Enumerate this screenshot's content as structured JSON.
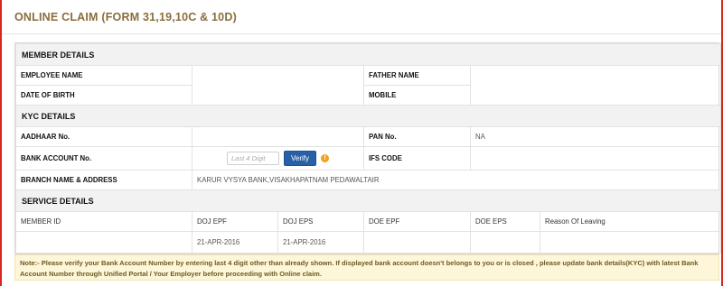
{
  "header": {
    "title": "ONLINE CLAIM (FORM 31,19,10C & 10D)"
  },
  "member_details": {
    "section_title": "MEMBER DETAILS",
    "employee_name_label": "EMPLOYEE NAME",
    "employee_name_value": "",
    "father_name_label": "FATHER NAME",
    "father_name_value": "",
    "dob_label": "DATE OF BIRTH",
    "dob_value": "",
    "mobile_label": "MOBILE",
    "mobile_value": ""
  },
  "kyc_details": {
    "section_title": "KYC DETAILS",
    "aadhaar_label": "AADHAAR No.",
    "aadhaar_value": "",
    "pan_label": "PAN No.",
    "pan_value": "NA",
    "bank_account_label": "BANK ACCOUNT No.",
    "bank_input_placeholder": "Last 4 Digit",
    "verify_label": "Verify",
    "info_icon_glyph": "!",
    "ifsc_label": "IFS CODE",
    "ifsc_value": "",
    "branch_label": "BRANCH NAME & ADDRESS",
    "branch_value": "KARUR VYSYA BANK,VISAKHAPATNAM PEDAWALTAIR"
  },
  "service_details": {
    "section_title": "SERVICE DETAILS",
    "columns": [
      "MEMBER ID",
      "DOJ EPF",
      "DOJ EPS",
      "DOE EPF",
      "DOE EPS",
      "Reason Of Leaving"
    ],
    "rows": [
      [
        "",
        "21-APR-2016",
        "21-APR-2016",
        "",
        "",
        ""
      ]
    ]
  },
  "note": "Note:- Please verify your Bank Account Number by entering last 4 digit other than already shown. If displayed bank account doesn't belongs to you or is closed , please update bank details(KYC) with latest Bank Account Number through Unified Portal / Your Employer before proceeding with Online claim.",
  "colors": {
    "title": "#8a6d3b",
    "verify_button": "#2860a8",
    "info_icon": "#f0a020",
    "note_background": "#fdf6d8",
    "window_border": "#d9261c"
  }
}
